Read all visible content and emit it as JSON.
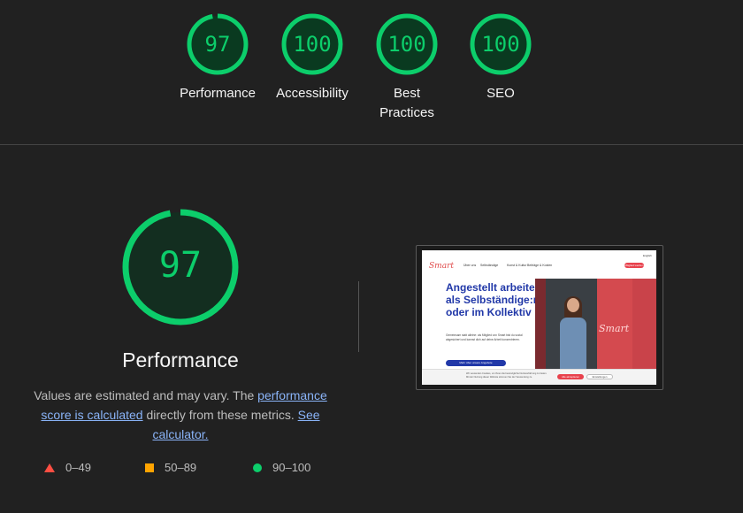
{
  "summary": {
    "categories": [
      {
        "score": "97",
        "label": "Performance",
        "fraction": 0.97
      },
      {
        "score": "100",
        "label": "Accessibility",
        "fraction": 1.0
      },
      {
        "score": "100",
        "label": "Best Practices",
        "fraction": 1.0
      },
      {
        "score": "100",
        "label": "SEO",
        "fraction": 1.0
      }
    ]
  },
  "performance": {
    "score": "97",
    "fraction": 0.97,
    "title": "Performance",
    "desc_prefix": "Values are estimated and may vary. The ",
    "desc_link1": "performance score is calculated",
    "desc_middle": " directly from these metrics. ",
    "desc_link2": "See calculator.",
    "legend": [
      {
        "range": "0–49",
        "shape": "triangle",
        "color": "#ff4e42"
      },
      {
        "range": "50–89",
        "shape": "square",
        "color": "#ffa400"
      },
      {
        "range": "90–100",
        "shape": "circle",
        "color": "#0cce6b"
      }
    ]
  },
  "screenshot": {
    "logo": "Smart",
    "nav": [
      "Über uns",
      "Selbständige",
      "Kunst & Kultur",
      "Beiträge & Kosten"
    ],
    "nav_button": "Mitglied werden",
    "lang": "English",
    "headline": "Angestellt arbeiten als Selbständige:r oder im Kollektiv",
    "body": "Gemeinsam statt alleine: als Mitglied von Smart bist du sozial abgesichert und kannst dich auf deine Arbeit konzentrieren.",
    "cta": "Mehr über unsere Angebote",
    "photo_sign": "Smart",
    "cookie_text": "Wir verwenden Cookies, um Ihnen die bestmögliche Nutzererfahrung zu bieten. Mit der Nutzung dieser Website stimmen Sie der Verwendung zu.",
    "cookie_accept": "Alle akzeptieren",
    "cookie_settings": "Einstellungen"
  },
  "colors": {
    "pass": "#0cce6b",
    "pass_bg": "#0a3a20",
    "background": "#212121"
  }
}
